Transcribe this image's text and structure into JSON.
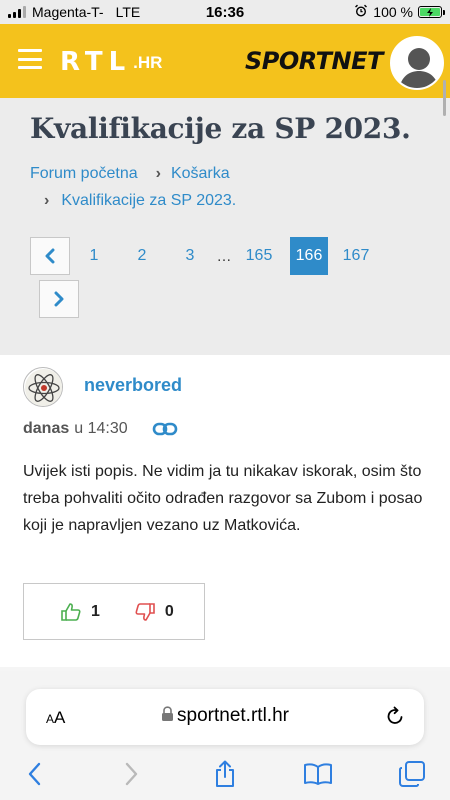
{
  "status_bar": {
    "carrier": "Magenta-T-",
    "network": "LTE",
    "time": "16:36",
    "battery": "100 %"
  },
  "header": {
    "logo_rtl": "RTL",
    "logo_hr": ".HR",
    "logo_sportnet": "SPORTNET"
  },
  "page": {
    "title": "Kvalifikacije za SP 2023.",
    "breadcrumb": [
      "Forum početna",
      "Košarka",
      "Kvalifikacije za SP 2023."
    ]
  },
  "pagination": {
    "pages": [
      "1",
      "2",
      "3",
      "…",
      "165",
      "166",
      "167"
    ],
    "current": "166"
  },
  "post": {
    "username": "neverbored",
    "date_bold": "danas",
    "date_rest": "u 14:30",
    "text": "Uvijek isti popis. Ne vidim ja tu nikakav iskorak, osim što treba pohvaliti očito odrađen razgovor sa Zubom i posao koji je napravljen vezano uz Matkovića.",
    "likes": "1",
    "dislikes": "0"
  },
  "browser": {
    "aa_small": "A",
    "aa_large": "A",
    "url": "sportnet.rtl.hr"
  },
  "colors": {
    "header_yellow": "#f4c21c",
    "link_blue": "#2f8bc9",
    "like_green": "#4caf50",
    "dislike_red": "#e05050"
  }
}
